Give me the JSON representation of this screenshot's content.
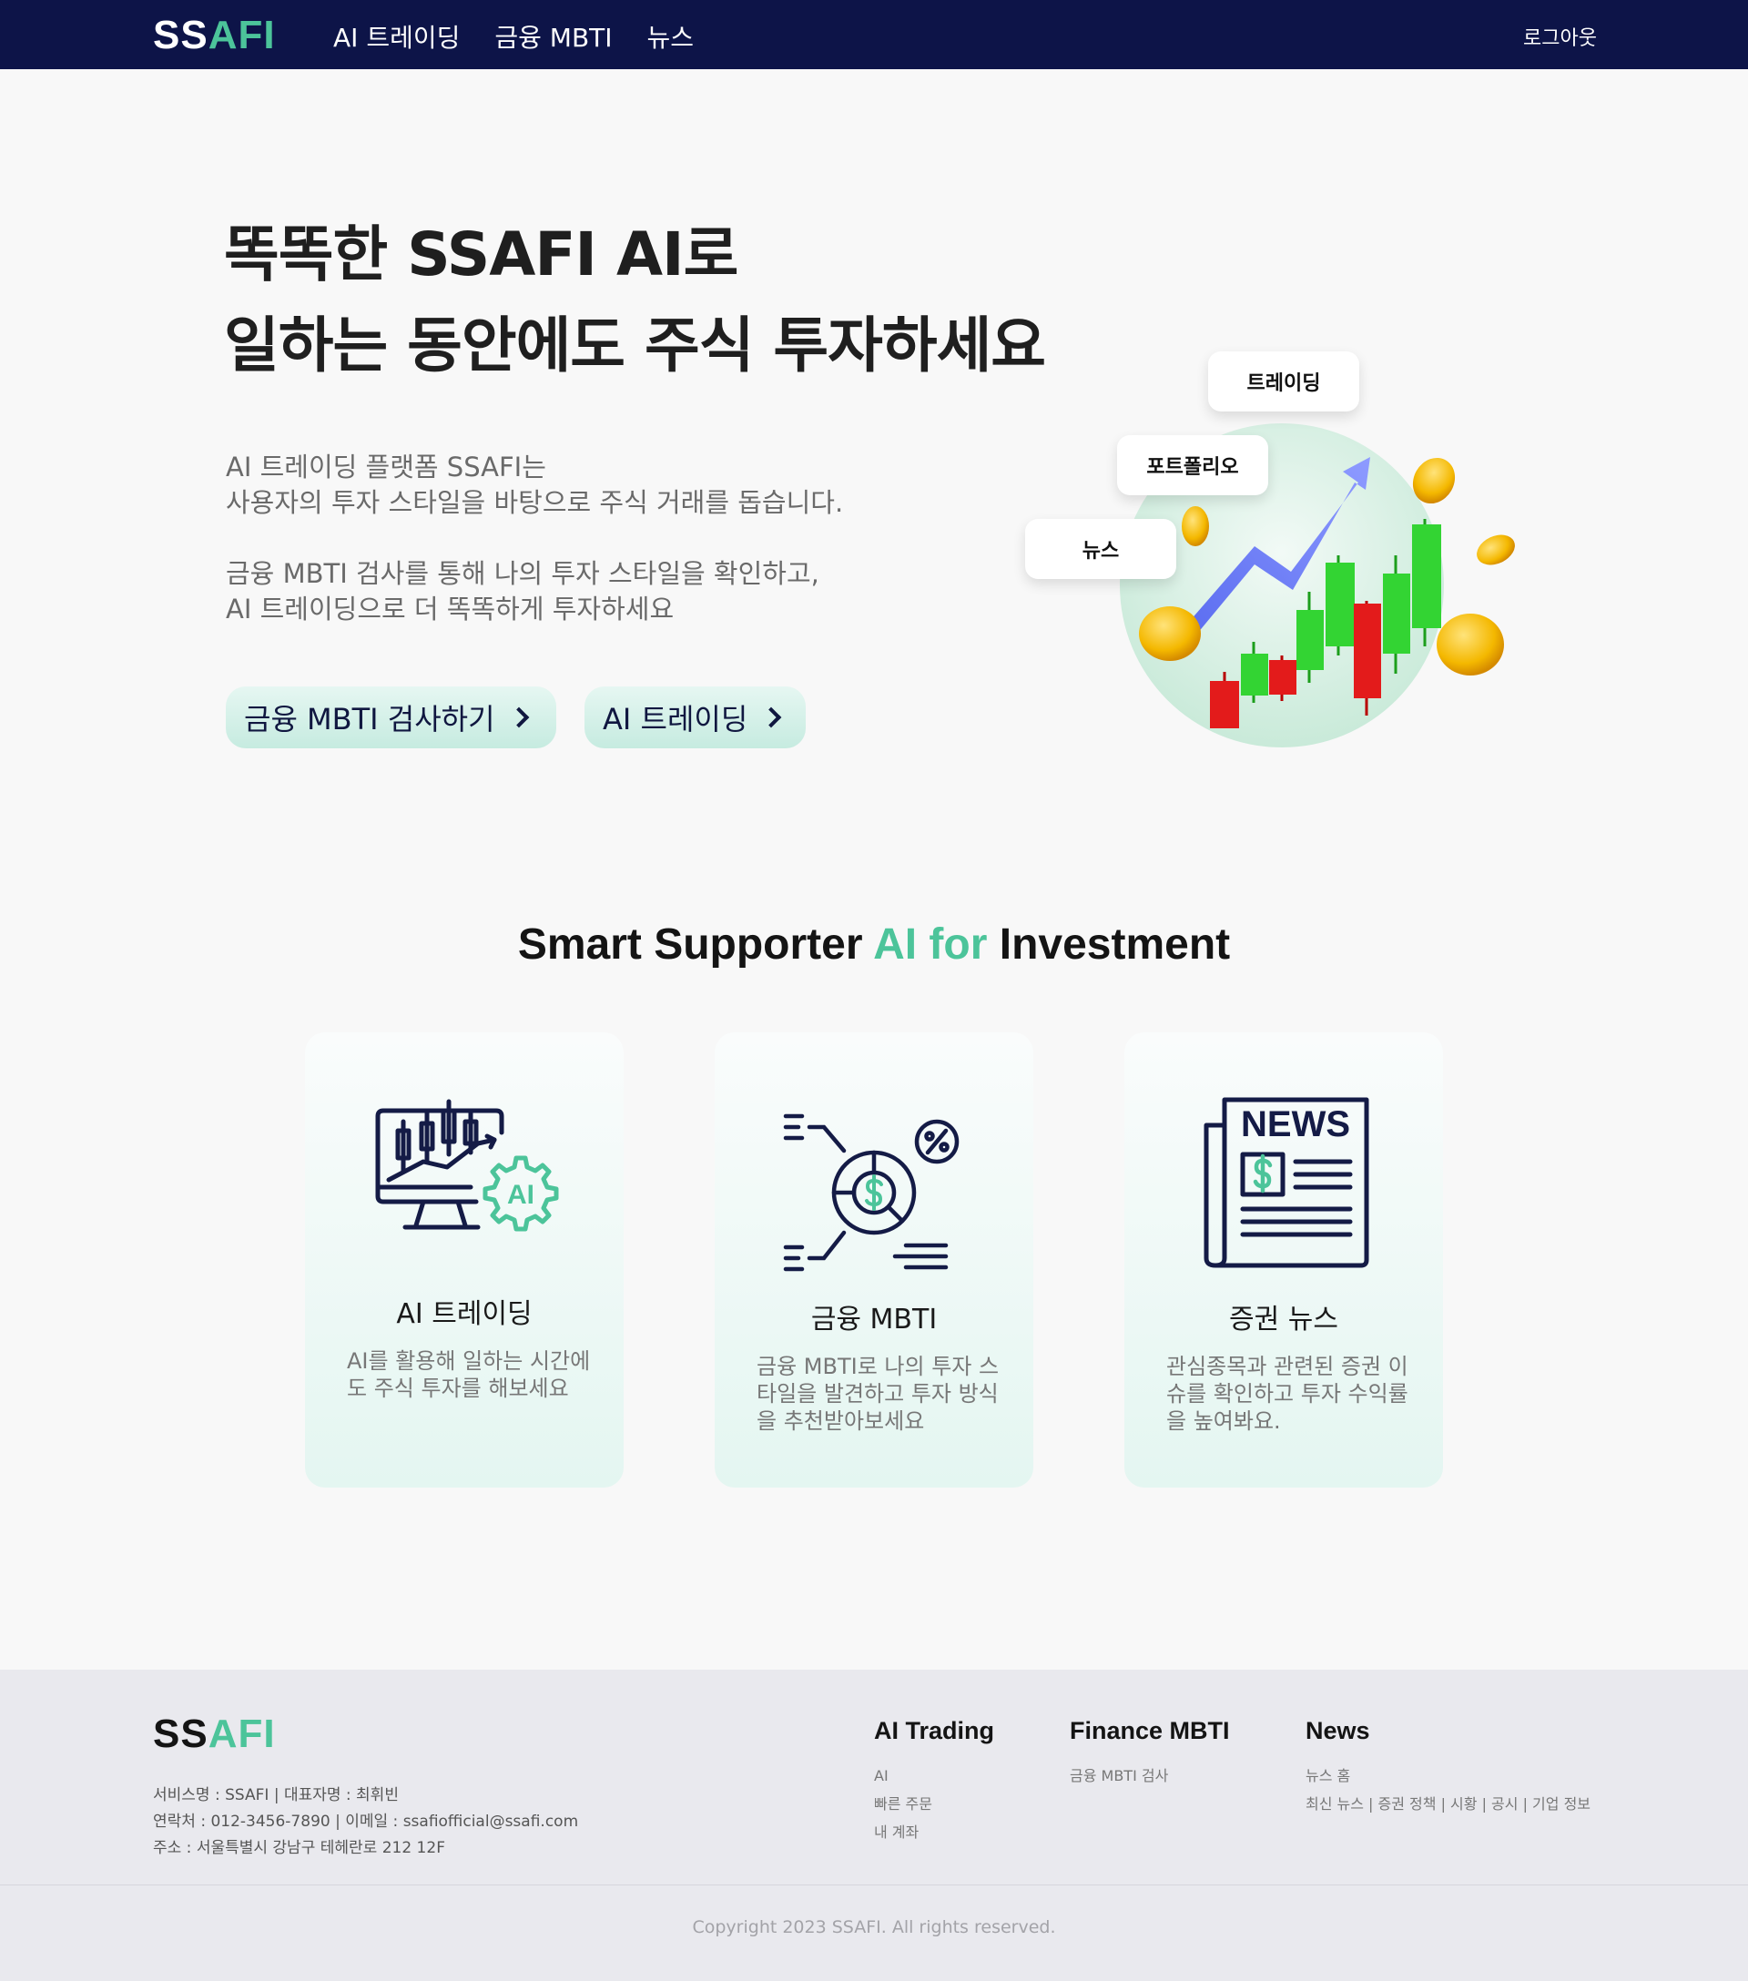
{
  "nav": {
    "logo_main": "SS",
    "logo_accent": "AFI",
    "links": [
      "AI 트레이딩",
      "금융 MBTI",
      "뉴스"
    ],
    "logout": "로그아웃"
  },
  "hero": {
    "title_line1": "똑똑한 SSAFI AI로",
    "title_line2": "일하는 동안에도 주식 투자하세요",
    "desc_line1": "AI 트레이딩 플랫폼 SSAFI는",
    "desc_line2": "사용자의 투자 스타일을 바탕으로 주식 거래를 돕습니다.",
    "desc_line3": "금융 MBTI 검사를 통해 나의 투자 스타일을 확인하고,",
    "desc_line4": "AI 트레이딩으로 더 똑똑하게 투자하세요",
    "btn_mbti": "금융 MBTI 검사하기",
    "btn_ai": "AI 트레이딩",
    "tags": [
      "트레이딩",
      "포트폴리오",
      "뉴스"
    ]
  },
  "section": {
    "title_part1": "Smart Supporter ",
    "title_accent": "AI for",
    "title_part2": " Investment"
  },
  "cards": [
    {
      "icon": "ai-trading-monitor-icon",
      "title": "AI 트레이딩",
      "desc": [
        "AI를 활용해 일하는 시간에",
        "도 주식 투자를 해보세요"
      ]
    },
    {
      "icon": "finance-chart-percent-icon",
      "title": "금융 MBTI",
      "desc": [
        "금융 MBTI로 나의 투자 스",
        "타일을 발견하고 투자 방식",
        "을 추천받아보세요"
      ]
    },
    {
      "icon": "newspaper-icon",
      "icon_text": "NEWS",
      "title": "증권 뉴스",
      "desc": [
        "관심종목과 관련된 증권 이",
        "슈를 확인하고 투자 수익률",
        "을 높여봐요."
      ]
    }
  ],
  "footer": {
    "logo_main": "SS",
    "logo_accent": "AFI",
    "info": [
      "서비스명 : SSAFI | 대표자명 : 최휘빈",
      "연락처 : 012-3456-7890 | 이메일 : ssafiofficial@ssafi.com",
      "주소 : 서울특별시 강남구 테헤란로 212 12F"
    ],
    "columns": [
      {
        "title": "AI Trading",
        "items": [
          "AI",
          "빠른 주문",
          "내 계좌"
        ]
      },
      {
        "title": "Finance MBTI",
        "items": [
          "금융 MBTI 검사"
        ]
      },
      {
        "title": "News",
        "items": [
          "뉴스 홈",
          "최신 뉴스 | 증권 정책 | 시황 | 공시 | 기업 정보"
        ]
      }
    ],
    "copyright": "Copyright 2023 SSAFI. All rights reserved."
  },
  "colors": {
    "nav_bg": "#0d1448",
    "accent": "#4cc49a",
    "card_gradient_bottom": "#e4f6f1",
    "footer_bg": "#e9e9ee"
  }
}
